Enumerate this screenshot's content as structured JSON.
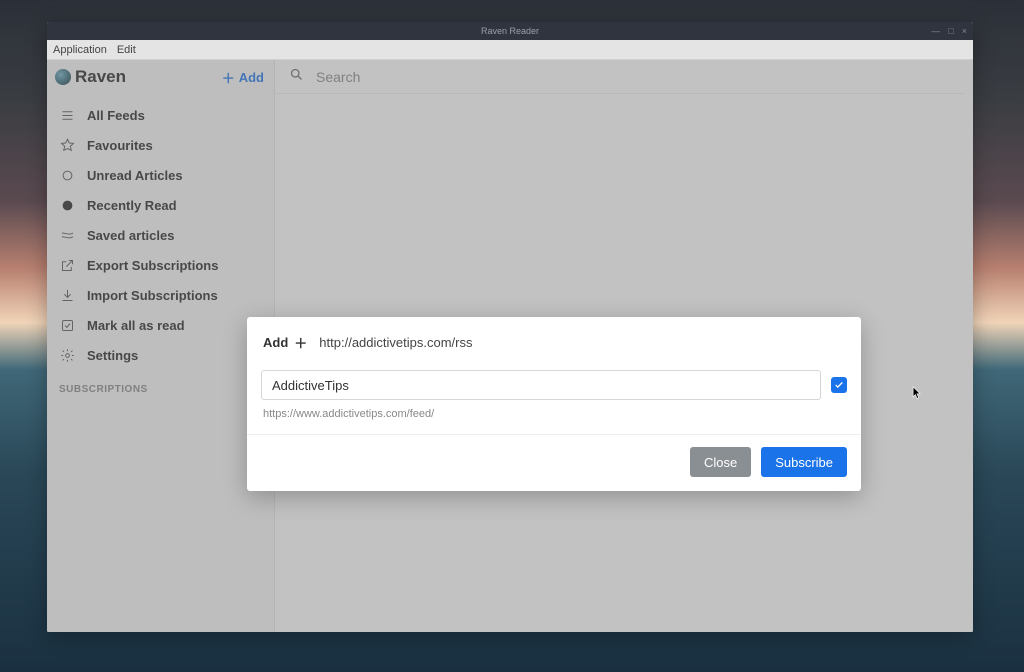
{
  "window": {
    "title": "Raven Reader"
  },
  "menubar": {
    "application": "Application",
    "edit": "Edit"
  },
  "brand": {
    "name": "Raven"
  },
  "sidebar": {
    "add_label": "Add",
    "items": [
      {
        "label": "All Feeds"
      },
      {
        "label": "Favourites"
      },
      {
        "label": "Unread Articles"
      },
      {
        "label": "Recently Read"
      },
      {
        "label": "Saved articles"
      },
      {
        "label": "Export Subscriptions"
      },
      {
        "label": "Import Subscriptions"
      },
      {
        "label": "Mark all as read"
      },
      {
        "label": "Settings"
      }
    ],
    "subscriptions_heading": "SUBSCRIPTIONS"
  },
  "search": {
    "placeholder": "Search"
  },
  "modal": {
    "add_label": "Add",
    "url_value": "http://addictivetips.com/rss",
    "feed_name": "AddictiveTips",
    "resolved_url": "https://www.addictivetips.com/feed/",
    "close_label": "Close",
    "subscribe_label": "Subscribe",
    "checked": true
  }
}
